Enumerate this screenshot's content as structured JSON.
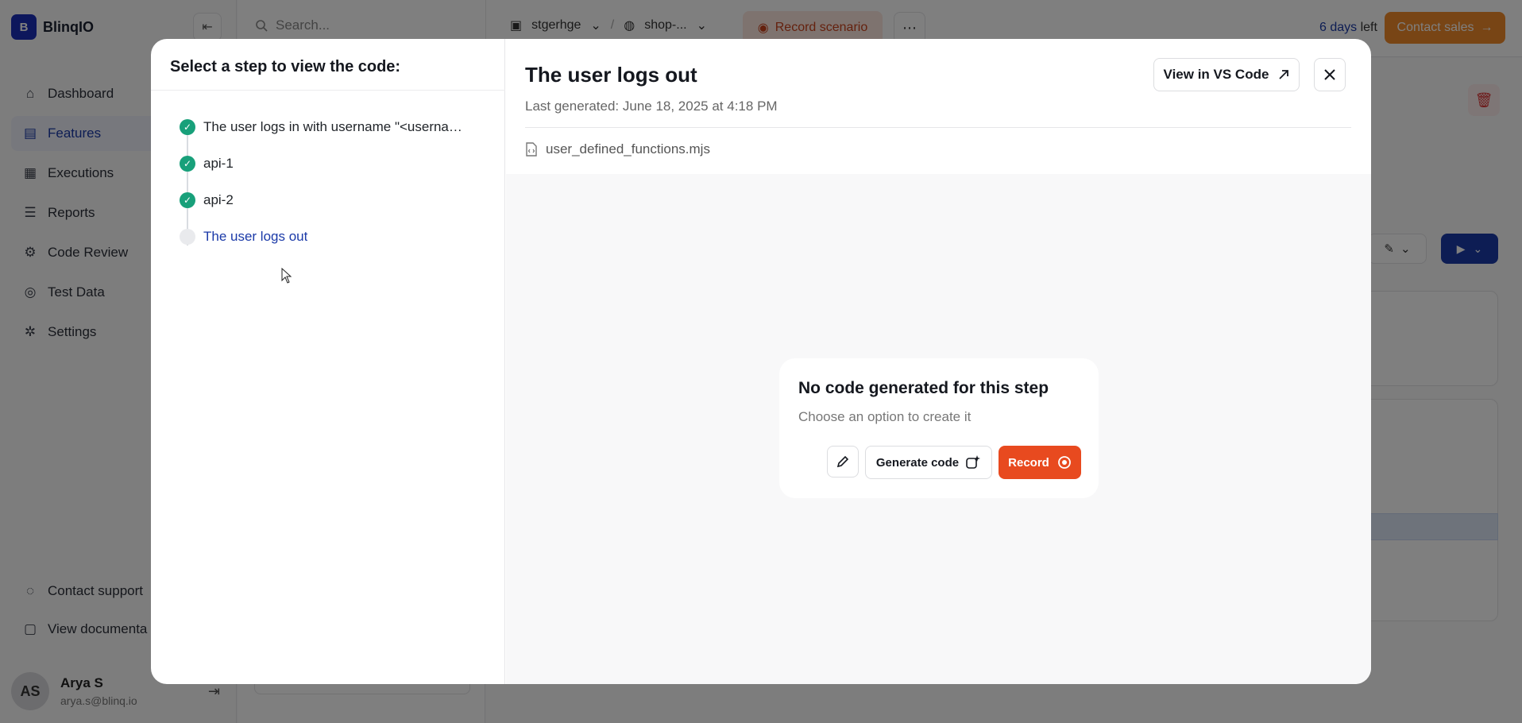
{
  "app": {
    "logo_text": "BlinqIO",
    "logo_mark": "B"
  },
  "sidebar": {
    "items": [
      {
        "label": "Dashboard",
        "icon": "home-icon",
        "glyph": "⌂"
      },
      {
        "label": "Features",
        "icon": "features-icon",
        "glyph": "▤"
      },
      {
        "label": "Executions",
        "icon": "calendar-icon",
        "glyph": "▦"
      },
      {
        "label": "Reports",
        "icon": "reports-icon",
        "glyph": "☰"
      },
      {
        "label": "Code Review",
        "icon": "code-review-icon",
        "glyph": "⚙"
      },
      {
        "label": "Test Data",
        "icon": "database-icon",
        "glyph": "◎"
      },
      {
        "label": "Settings",
        "icon": "settings-icon",
        "glyph": "✲"
      }
    ],
    "bottom": [
      {
        "label": "Contact support",
        "icon": "chat-icon",
        "glyph": "◌"
      },
      {
        "label": "View documenta",
        "icon": "document-icon",
        "glyph": "▢"
      }
    ],
    "user": {
      "initials": "AS",
      "name": "Arya S",
      "email": "arya.s@blinq.io"
    }
  },
  "topbar": {
    "search_placeholder": "Search...",
    "project": "stgerhge",
    "separator": "/",
    "environment": "shop-...",
    "record_scenario": "Record scenario",
    "trial_days": "6 days",
    "trial_suffix": "left",
    "contact_sales": "Contact sales"
  },
  "modal": {
    "steps_title": "Select a step to view the code:",
    "steps": [
      {
        "label": "The user logs in with username \"<username>\" and password \"<password>\"",
        "status": "done"
      },
      {
        "label": "api-1",
        "status": "done"
      },
      {
        "label": "api-2",
        "status": "done"
      },
      {
        "label": "The user logs out",
        "status": "pending"
      }
    ],
    "code_title": "The user logs out",
    "last_generated": "Last generated: June 18, 2025 at 4:18 PM",
    "vscode_label": "View in VS Code",
    "file_name": "user_defined_functions.mjs",
    "empty_title": "No code generated for this step",
    "empty_subtitle": "Choose an option to create it",
    "generate_label": "Generate code",
    "record_label": "Record"
  },
  "colors": {
    "accent": "#1b3aa8",
    "success": "#18a07a",
    "record": "#e84a1f",
    "sales": "#f08a2a"
  }
}
